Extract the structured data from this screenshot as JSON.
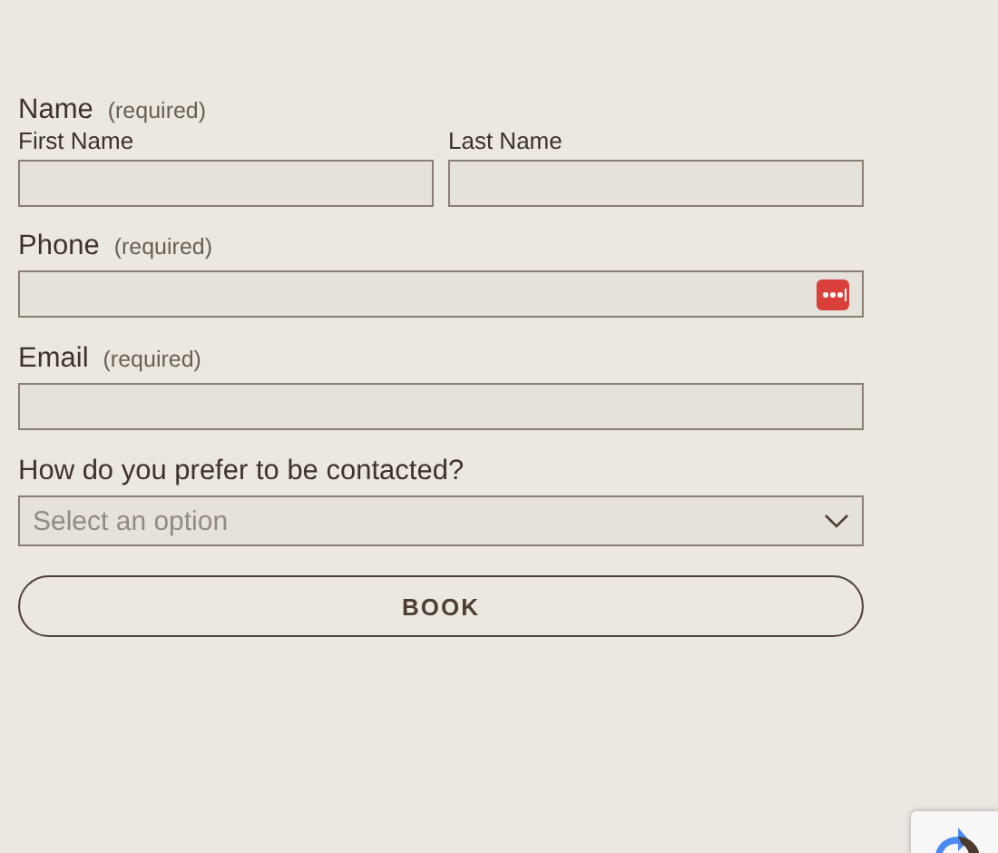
{
  "form": {
    "groups": [
      {
        "kind": "split",
        "label": "Name",
        "note": "(required)",
        "fields": [
          {
            "label": "First Name"
          },
          {
            "label": "Last Name"
          }
        ]
      },
      {
        "kind": "text",
        "label": "Phone",
        "note": "(required)",
        "autofill_icon": true
      },
      {
        "kind": "text",
        "label": "Email",
        "note": "(required)",
        "autofill_icon": false
      },
      {
        "kind": "select",
        "label": "How do you prefer to be contacted?",
        "placeholder": "Select an option"
      }
    ],
    "submit": "BOOK"
  }
}
